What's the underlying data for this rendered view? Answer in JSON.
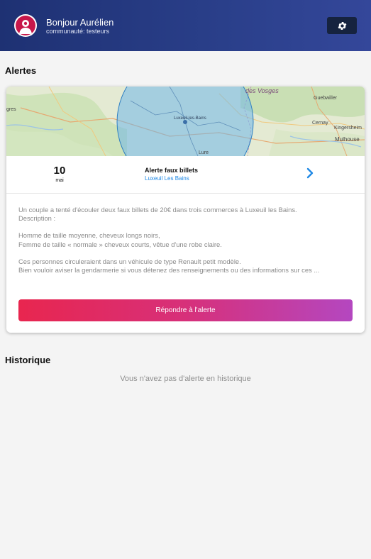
{
  "header": {
    "greeting": "Bonjour Aurélien",
    "community": "communauté: testeurs"
  },
  "alerts_section": {
    "title": "Alertes"
  },
  "alert": {
    "map_labels": {
      "region": "des Vosges",
      "guebwiller": "Guebwiller",
      "cernay": "Cernay",
      "kingersheim": "Kingersheim",
      "mulhouse": "Mulhouse",
      "luxeuil": "Luxeuil-les-Bains",
      "gres": "gres",
      "lure": "Lure"
    },
    "day": "10",
    "month": "mai",
    "title": "Alerte faux billets",
    "location": "Luxeuil Les Bains",
    "description": [
      "Un couple a tenté d'écouler deux faux billets de 20€ dans trois commerces à Luxeuil les Bains.",
      "Description :",
      "",
      "Homme de taille moyenne, cheveux longs noirs,",
      "Femme de taille « normale » cheveux courts, vêtue d'une robe claire.",
      "",
      "Ces personnes circuleraient dans un véhicule de type Renault petit modèle.",
      "Bien vouloir aviser la gendarmerie si vous détenez des renseignements ou des informations sur ces ..."
    ],
    "respond_label": "Répondre à l'alerte"
  },
  "history_section": {
    "title": "Historique",
    "empty_message": "Vous n'avez pas d'alerte en historique"
  },
  "colors": {
    "header_start": "#1e3173",
    "header_end": "#34479a",
    "accent_blue": "#1e88e5",
    "button_start": "#e8264f",
    "button_end": "#b447c0",
    "avatar_red": "#c8174a"
  },
  "icons": {
    "avatar": "user-avatar-icon",
    "settings": "gear-icon",
    "chevron": "chevron-right-icon"
  }
}
